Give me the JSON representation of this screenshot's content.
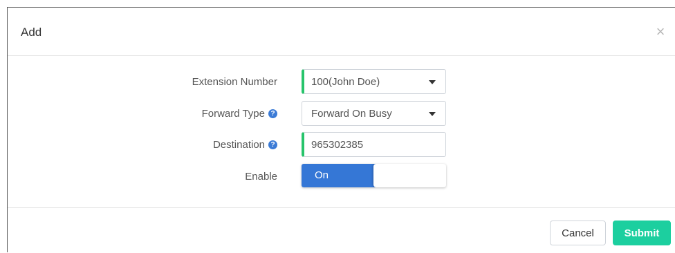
{
  "dialog": {
    "title": "Add",
    "close_glyph": "×"
  },
  "form": {
    "extension": {
      "label": "Extension Number",
      "value": "100(John Doe)"
    },
    "forward_type": {
      "label": "Forward Type",
      "value": "Forward On Busy"
    },
    "destination": {
      "label": "Destination",
      "value": "965302385"
    },
    "enable": {
      "label": "Enable",
      "state": "On"
    }
  },
  "help_glyph": "?",
  "footer": {
    "cancel_label": "Cancel",
    "submit_label": "Submit"
  },
  "colors": {
    "required_marker": "#27c46b",
    "toggle_on": "#3577d6",
    "submit": "#1ccf9f",
    "help_icon": "#3b7bd6"
  }
}
